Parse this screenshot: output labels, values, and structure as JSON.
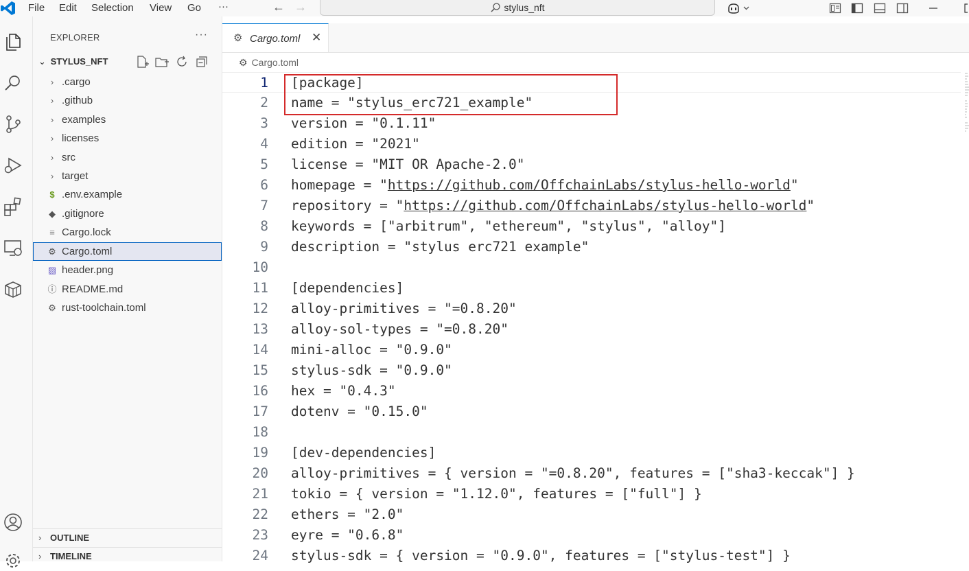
{
  "menu": {
    "items": [
      "File",
      "Edit",
      "Selection",
      "View",
      "Go"
    ],
    "more": "···"
  },
  "titlebar": {
    "search_text": "stylus_nft"
  },
  "sidebar": {
    "title": "EXPLORER",
    "more": "···",
    "project": "STYLUS_NFT",
    "items": [
      {
        "label": ".cargo",
        "kind": "folder"
      },
      {
        "label": ".github",
        "kind": "folder"
      },
      {
        "label": "examples",
        "kind": "folder"
      },
      {
        "label": "licenses",
        "kind": "folder"
      },
      {
        "label": "src",
        "kind": "folder"
      },
      {
        "label": "target",
        "kind": "folder"
      },
      {
        "label": ".env.example",
        "kind": "env"
      },
      {
        "label": ".gitignore",
        "kind": "git"
      },
      {
        "label": "Cargo.lock",
        "kind": "lock"
      },
      {
        "label": "Cargo.toml",
        "kind": "toml",
        "selected": true
      },
      {
        "label": "header.png",
        "kind": "image"
      },
      {
        "label": "README.md",
        "kind": "info"
      },
      {
        "label": "rust-toolchain.toml",
        "kind": "toml"
      }
    ],
    "outline": "OUTLINE",
    "timeline": "TIMELINE"
  },
  "editor": {
    "tab_name": "Cargo.toml",
    "tab_close": "✕",
    "breadcrumb": "Cargo.toml",
    "lines": [
      {
        "n": "1",
        "text": "[package]"
      },
      {
        "n": "2",
        "text": "name = \"stylus_erc721_example\""
      },
      {
        "n": "3",
        "text": "version = \"0.1.11\""
      },
      {
        "n": "4",
        "text": "edition = \"2021\""
      },
      {
        "n": "5",
        "text": "license = \"MIT OR Apache-2.0\""
      },
      {
        "n": "6",
        "pre": "homepage = \"",
        "link": "https://github.com/OffchainLabs/stylus-hello-world",
        "post": "\""
      },
      {
        "n": "7",
        "pre": "repository = \"",
        "link": "https://github.com/OffchainLabs/stylus-hello-world",
        "post": "\""
      },
      {
        "n": "8",
        "text": "keywords = [\"arbitrum\", \"ethereum\", \"stylus\", \"alloy\"]"
      },
      {
        "n": "9",
        "text": "description = \"stylus erc721 example\""
      },
      {
        "n": "10",
        "text": ""
      },
      {
        "n": "11",
        "text": "[dependencies]"
      },
      {
        "n": "12",
        "text": "alloy-primitives = \"=0.8.20\""
      },
      {
        "n": "13",
        "text": "alloy-sol-types = \"=0.8.20\""
      },
      {
        "n": "14",
        "text": "mini-alloc = \"0.9.0\""
      },
      {
        "n": "15",
        "text": "stylus-sdk = \"0.9.0\""
      },
      {
        "n": "16",
        "text": "hex = \"0.4.3\""
      },
      {
        "n": "17",
        "text": "dotenv = \"0.15.0\""
      },
      {
        "n": "18",
        "text": ""
      },
      {
        "n": "19",
        "text": "[dev-dependencies]"
      },
      {
        "n": "20",
        "text": "alloy-primitives = { version = \"=0.8.20\", features = [\"sha3-keccak\"] }"
      },
      {
        "n": "21",
        "text": "tokio = { version = \"1.12.0\", features = [\"full\"] }"
      },
      {
        "n": "22",
        "text": "ethers = \"2.0\""
      },
      {
        "n": "23",
        "text": "eyre = \"0.6.8\""
      },
      {
        "n": "24",
        "text": "stylus-sdk = { version = \"0.9.0\", features = [\"stylus-test\"] }"
      }
    ]
  }
}
